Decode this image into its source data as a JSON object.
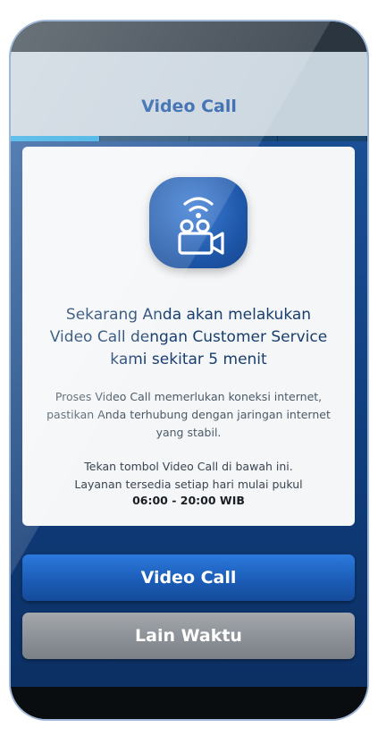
{
  "header": {
    "title": "Video Call"
  },
  "card": {
    "icon": "video-camera-wifi-icon",
    "headline_lines": [
      "Sekarang Anda akan melakukan",
      "Video Call dengan Customer Service",
      "kami sekitar 5 menit"
    ],
    "description_lines": [
      "Proses Video Call memerlukan koneksi internet,",
      "pastikan Anda terhubung dengan jaringan internet",
      "yang stabil."
    ],
    "instruction_lines": [
      "Tekan tombol Video Call di bawah ini.",
      "Layanan tersedia setiap hari mulai pukul"
    ],
    "hours": "06:00 - 20:00 WIB"
  },
  "buttons": {
    "video_call": "Video Call",
    "later": "Lain Waktu"
  },
  "colors": {
    "header_title": "#1d56a4",
    "primary_button": "#1c5db8",
    "secondary_button": "#8e9399",
    "active_tab": "#29a8e1"
  }
}
